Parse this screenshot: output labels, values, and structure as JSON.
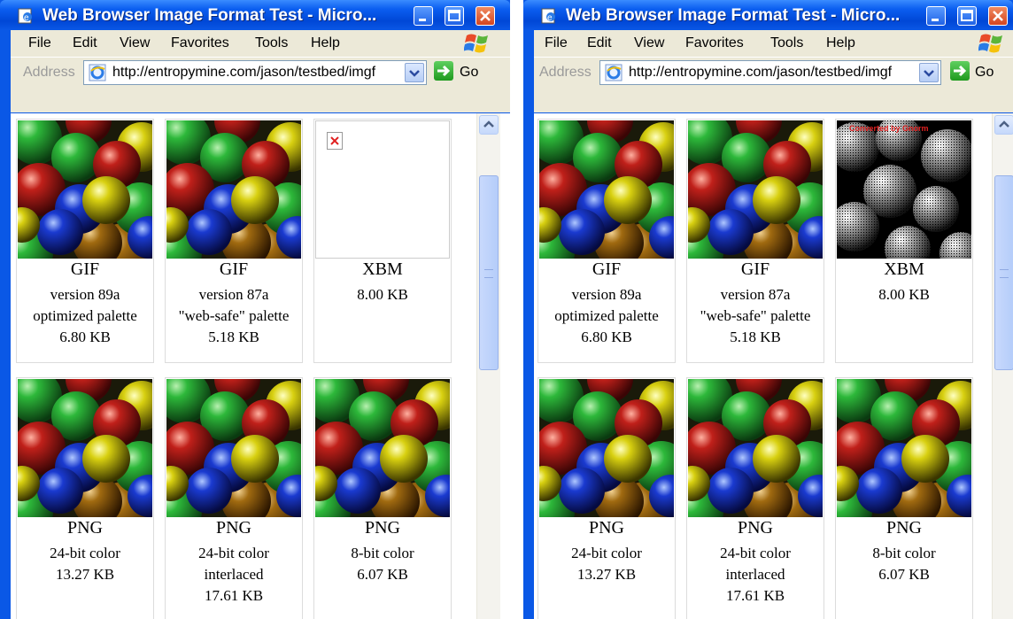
{
  "windows": [
    {
      "title": "Web Browser Image Format Test - Micro...",
      "menu": [
        "File",
        "Edit",
        "View",
        "Favorites",
        "Tools",
        "Help"
      ],
      "address_label": "Address",
      "url": "http://entropymine.com/jason/testbed/imgf",
      "go_label": "Go",
      "cells": [
        {
          "format": "GIF",
          "lines": [
            "version 89a",
            "optimized palette",
            "6.80 KB"
          ],
          "image": "candy-balls",
          "broken": false
        },
        {
          "format": "GIF",
          "lines": [
            "version 87a",
            "\"web-safe\" palette",
            "5.18 KB"
          ],
          "image": "candy-balls",
          "broken": false
        },
        {
          "format": "XBM",
          "lines": [
            "8.00 KB",
            "",
            ""
          ],
          "image": "broken-image-icon",
          "broken": true
        },
        {
          "format": "PNG",
          "lines": [
            "24-bit color",
            "13.27 KB",
            ""
          ],
          "image": "candy-balls",
          "broken": false
        },
        {
          "format": "PNG",
          "lines": [
            "24-bit color",
            "interlaced",
            "17.61 KB"
          ],
          "image": "candy-balls",
          "broken": false
        },
        {
          "format": "PNG",
          "lines": [
            "8-bit color",
            "6.07 KB",
            ""
          ],
          "image": "candy-balls",
          "broken": false
        }
      ]
    },
    {
      "title": "Web Browser Image Format Test - Micro...",
      "menu": [
        "File",
        "Edit",
        "View",
        "Favorites",
        "Tools",
        "Help"
      ],
      "address_label": "Address",
      "url": "http://entropymine.com/jason/testbed/imgf",
      "go_label": "Go",
      "cells": [
        {
          "format": "GIF",
          "lines": [
            "version 89a",
            "optimized palette",
            "6.80 KB"
          ],
          "image": "candy-balls",
          "broken": false
        },
        {
          "format": "GIF",
          "lines": [
            "version 87a",
            "\"web-safe\" palette",
            "5.18 KB"
          ],
          "image": "candy-balls",
          "broken": false
        },
        {
          "format": "XBM",
          "lines": [
            "8.00 KB",
            "",
            ""
          ],
          "image": "candy-balls-monochrome",
          "broken": false,
          "overlay_text": "Converted by Gnorm"
        },
        {
          "format": "PNG",
          "lines": [
            "24-bit color",
            "13.27 KB",
            ""
          ],
          "image": "candy-balls",
          "broken": false
        },
        {
          "format": "PNG",
          "lines": [
            "24-bit color",
            "interlaced",
            "17.61 KB"
          ],
          "image": "candy-balls",
          "broken": false
        },
        {
          "format": "PNG",
          "lines": [
            "8-bit color",
            "6.07 KB",
            ""
          ],
          "image": "candy-balls",
          "broken": false
        }
      ]
    }
  ],
  "colors": {
    "titlebar": "#0a58e6",
    "chrome": "#ece9d8",
    "close_button": "#d44520"
  }
}
